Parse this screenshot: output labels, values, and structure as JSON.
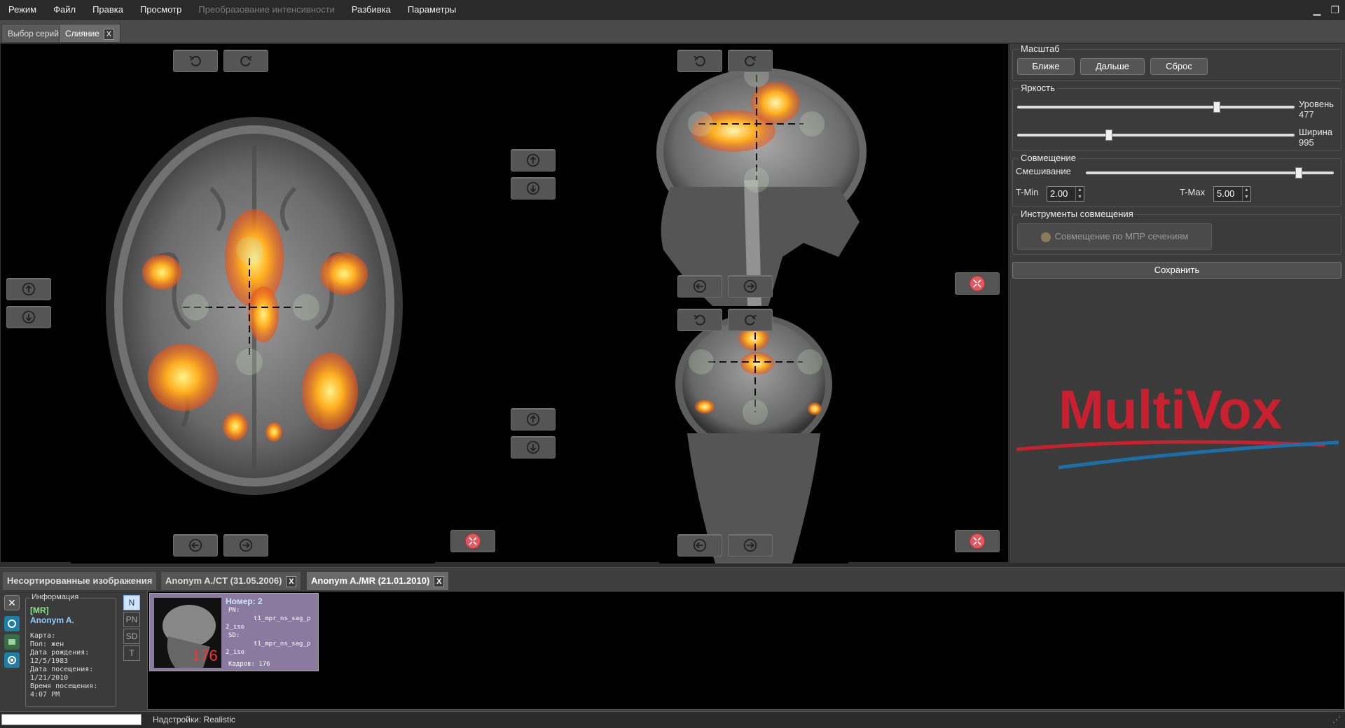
{
  "menu": {
    "items": [
      "Режим",
      "Файл",
      "Правка",
      "Просмотр",
      "Преобразование интенсивности",
      "Разбивка",
      "Параметры"
    ],
    "disabled_index": 4,
    "window_controls": [
      "▁",
      "❐"
    ]
  },
  "tabs": {
    "series_select": "Выбор серий",
    "fusion": "Слияние",
    "close_label": "X"
  },
  "right_panel": {
    "scale": {
      "title": "Масштаб",
      "closer": "Ближе",
      "farther": "Дальше",
      "reset": "Сброс"
    },
    "brightness": {
      "title": "Яркость",
      "level_label": "Уровень",
      "level_value": "477",
      "level_fraction": 0.72,
      "width_label": "Ширина",
      "width_value": "995",
      "width_fraction": 0.33
    },
    "fusion": {
      "title": "Совмещение",
      "mix_label": "Смешивание",
      "mix_fraction": 0.86,
      "tmin_label": "T-Min",
      "tmin_value": "2.00",
      "tmax_label": "T-Max",
      "tmax_value": "5.00"
    },
    "fusion_tools": {
      "title": "Инструменты совмещения",
      "mpr_button": "Совмещение по МПР сечениям"
    },
    "save": "Сохранить",
    "logo_text": "MultiVox",
    "logo_color": "#c8202e"
  },
  "bottom_tabs": {
    "unsorted": "Несортированные изображения",
    "ct": "Anonym A./CT (31.05.2006)",
    "mr": "Anonym A./MR (21.01.2010)",
    "close_label": "X"
  },
  "patient_info": {
    "title": "Информация",
    "modality": "[MR]",
    "name": "Anonym A.",
    "card": "Карта:",
    "sex": "Пол: жен",
    "birth_label": "Дата рождения:",
    "birth_value": "12/5/1983",
    "visit_date_label": "Дата посещения:",
    "visit_date_value": "1/21/2010",
    "visit_time_label": "Время посещения:",
    "visit_time_value": "4:07 PM"
  },
  "view_buttons": [
    "N",
    "PN",
    "SD",
    "T"
  ],
  "series_card": {
    "number": "Номер: 2",
    "pn_label": "PN:",
    "pn_value_1": "t1_mpr_ns_sag_p",
    "pn_value_2": "2_iso",
    "sd_label": "SD:",
    "sd_value_1": "t1_mpr_ns_sag_p",
    "sd_value_2": "2_iso",
    "frames": "Кадров: 176",
    "frame_count_overlay": "176"
  },
  "statusbar": {
    "settings": "Надстройки: Realistic"
  }
}
